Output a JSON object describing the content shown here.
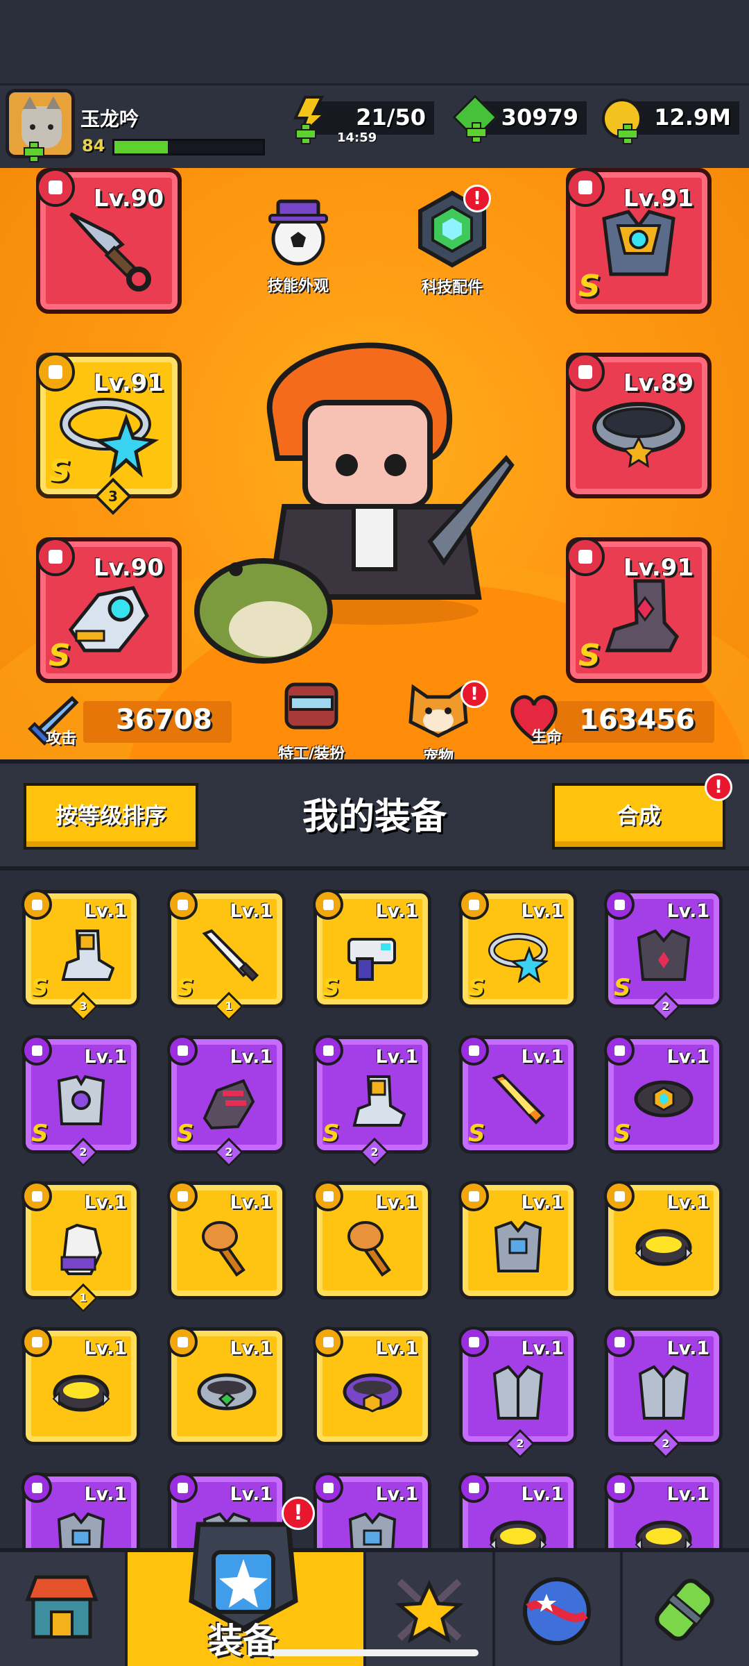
{
  "player": {
    "name": "玉龙吟",
    "level": "84",
    "xp_fraction": 0.36
  },
  "resources": {
    "energy": {
      "value": "21/50",
      "timer": "14:59",
      "icon": "lightning-icon"
    },
    "gems": {
      "value": "30979",
      "icon": "green-gem-icon"
    },
    "gold": {
      "value": "12.9M",
      "icon": "gold-coin-icon"
    }
  },
  "equipped": {
    "weapon": {
      "level": "Lv.90",
      "rarity": "",
      "icon": "kunai-icon"
    },
    "armor": {
      "level": "Lv.91",
      "rarity": "S",
      "icon": "robot-armor-icon"
    },
    "necklace": {
      "level": "Lv.91",
      "rarity": "S",
      "stars": "3",
      "icon": "star-ring-icon"
    },
    "belt": {
      "level": "Lv.89",
      "rarity": "",
      "icon": "belt-icon"
    },
    "gloves": {
      "level": "Lv.90",
      "rarity": "S",
      "icon": "gauntlet-icon"
    },
    "boots": {
      "level": "Lv.91",
      "rarity": "S",
      "icon": "boot-icon"
    }
  },
  "stage_buttons": {
    "skill_skin": "技能外观",
    "tech_parts": "科技配件",
    "agent_outfit": "特工/装扮",
    "pet": "宠物"
  },
  "stats": {
    "attack_label": "攻击",
    "attack": "36708",
    "hp_label": "生命",
    "hp": "163456"
  },
  "equipment_panel": {
    "title": "我的装备",
    "sort_button": "按等级排序",
    "merge_button": "合成",
    "items": [
      {
        "level": "Lv.1",
        "rarity": "S",
        "stars": "3",
        "color": "gold",
        "icon": "boot-icon"
      },
      {
        "level": "Lv.1",
        "rarity": "S",
        "stars": "1",
        "color": "gold",
        "icon": "sword-icon"
      },
      {
        "level": "Lv.1",
        "rarity": "S",
        "stars": "",
        "color": "gold",
        "icon": "blaster-icon"
      },
      {
        "level": "Lv.1",
        "rarity": "S",
        "stars": "",
        "color": "gold",
        "icon": "star-ring-icon"
      },
      {
        "level": "Lv.1",
        "rarity": "S",
        "stars": "2",
        "color": "purple",
        "icon": "dark-armor-icon"
      },
      {
        "level": "Lv.1",
        "rarity": "S",
        "stars": "2",
        "color": "purple",
        "icon": "mech-armor-icon"
      },
      {
        "level": "Lv.1",
        "rarity": "S",
        "stars": "2",
        "color": "purple",
        "icon": "claw-glove-icon"
      },
      {
        "level": "Lv.1",
        "rarity": "S",
        "stars": "2",
        "color": "purple",
        "icon": "boot-icon"
      },
      {
        "level": "Lv.1",
        "rarity": "S",
        "stars": "",
        "color": "purple",
        "icon": "flame-sword-icon"
      },
      {
        "level": "Lv.1",
        "rarity": "S",
        "stars": "",
        "color": "purple",
        "icon": "hex-belt-icon"
      },
      {
        "level": "Lv.1",
        "rarity": "",
        "stars": "1",
        "color": "gold",
        "icon": "glove-icon"
      },
      {
        "level": "Lv.1",
        "rarity": "",
        "stars": "",
        "color": "gold",
        "icon": "mace-icon"
      },
      {
        "level": "Lv.1",
        "rarity": "",
        "stars": "",
        "color": "gold",
        "icon": "mace-icon"
      },
      {
        "level": "Lv.1",
        "rarity": "",
        "stars": "",
        "color": "gold",
        "icon": "chest-armor-icon"
      },
      {
        "level": "Lv.1",
        "rarity": "",
        "stars": "",
        "color": "gold",
        "icon": "spiked-ring-icon"
      },
      {
        "level": "Lv.1",
        "rarity": "",
        "stars": "",
        "color": "gold",
        "icon": "spiked-ring-icon"
      },
      {
        "level": "Lv.1",
        "rarity": "",
        "stars": "",
        "color": "gold",
        "icon": "emerald-belt-icon"
      },
      {
        "level": "Lv.1",
        "rarity": "",
        "stars": "",
        "color": "gold",
        "icon": "purple-belt-icon"
      },
      {
        "level": "Lv.1",
        "rarity": "",
        "stars": "2",
        "color": "purple",
        "icon": "plate-armor-icon"
      },
      {
        "level": "Lv.1",
        "rarity": "",
        "stars": "2",
        "color": "purple",
        "icon": "plate-armor-icon"
      },
      {
        "level": "Lv.1",
        "rarity": "",
        "stars": "",
        "color": "purple",
        "icon": "chest-armor-icon"
      },
      {
        "level": "Lv.1",
        "rarity": "",
        "stars": "",
        "color": "purple",
        "icon": "chest-armor-icon"
      },
      {
        "level": "Lv.1",
        "rarity": "",
        "stars": "",
        "color": "purple",
        "icon": "chest-armor-icon"
      },
      {
        "level": "Lv.1",
        "rarity": "",
        "stars": "",
        "color": "purple",
        "icon": "spiked-ring-icon"
      },
      {
        "level": "Lv.1",
        "rarity": "",
        "stars": "",
        "color": "purple",
        "icon": "spiked-ring-icon"
      }
    ]
  },
  "bottom_nav": {
    "active_label": "装备",
    "items": [
      "shop-icon",
      "equipment-icon",
      "battle-icon",
      "planet-icon",
      "gene-icon"
    ]
  },
  "colors": {
    "stage": "#ff9a12",
    "rarity_gold": "#ffc411",
    "rarity_purple": "#a43ee6",
    "slot_red": "#ea3d52",
    "alert": "#e8172e"
  }
}
